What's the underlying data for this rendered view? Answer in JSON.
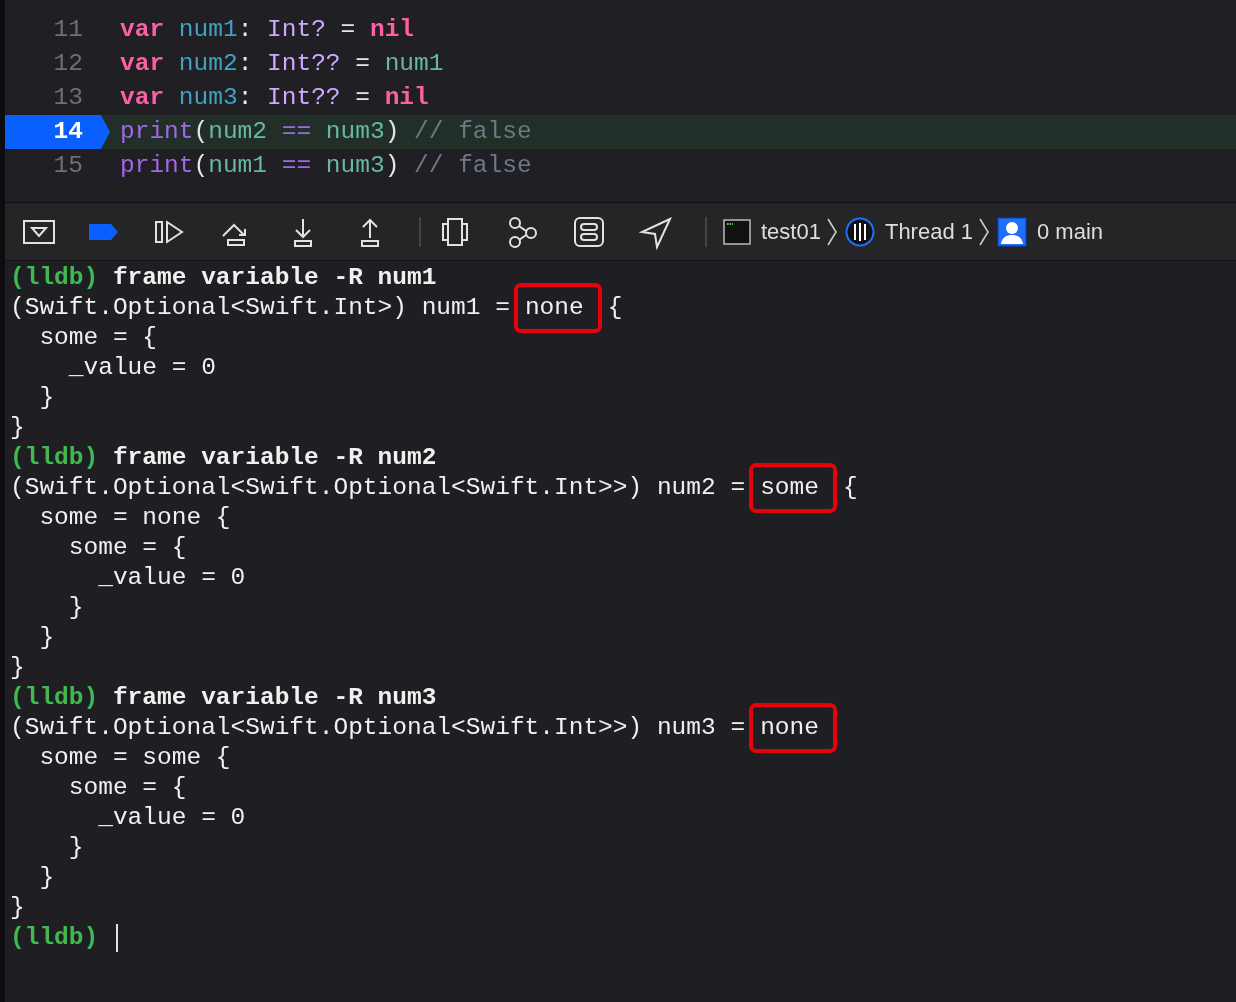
{
  "editor": {
    "lines": [
      {
        "number": "11",
        "current": false,
        "tokens": [
          {
            "kind": "keyword",
            "text": "var"
          },
          {
            "kind": "decl",
            "text": " num1"
          },
          {
            "kind": "plain",
            "text": ": "
          },
          {
            "kind": "type",
            "text": "Int?"
          },
          {
            "kind": "plain",
            "text": " = "
          },
          {
            "kind": "keyword",
            "text": "nil"
          }
        ]
      },
      {
        "number": "12",
        "current": false,
        "tokens": [
          {
            "kind": "keyword",
            "text": "var"
          },
          {
            "kind": "decl",
            "text": " num2"
          },
          {
            "kind": "plain",
            "text": ": "
          },
          {
            "kind": "type",
            "text": "Int??"
          },
          {
            "kind": "plain",
            "text": " = "
          },
          {
            "kind": "ref",
            "text": "num1"
          }
        ]
      },
      {
        "number": "13",
        "current": false,
        "tokens": [
          {
            "kind": "keyword",
            "text": "var"
          },
          {
            "kind": "decl",
            "text": " num3"
          },
          {
            "kind": "plain",
            "text": ": "
          },
          {
            "kind": "type",
            "text": "Int??"
          },
          {
            "kind": "plain",
            "text": " = "
          },
          {
            "kind": "keyword",
            "text": "nil"
          }
        ]
      },
      {
        "number": "14",
        "current": true,
        "tokens": [
          {
            "kind": "func",
            "text": "print"
          },
          {
            "kind": "plain",
            "text": "("
          },
          {
            "kind": "ref",
            "text": "num2"
          },
          {
            "kind": "op",
            "text": " =="
          },
          {
            "kind": "ref",
            "text": " num3"
          },
          {
            "kind": "plain",
            "text": ")"
          },
          {
            "kind": "comment",
            "text": " // false"
          }
        ]
      },
      {
        "number": "15",
        "current": false,
        "tokens": [
          {
            "kind": "func",
            "text": "print"
          },
          {
            "kind": "plain",
            "text": "("
          },
          {
            "kind": "ref",
            "text": "num1"
          },
          {
            "kind": "op",
            "text": " =="
          },
          {
            "kind": "ref",
            "text": " num3"
          },
          {
            "kind": "plain",
            "text": ")"
          },
          {
            "kind": "comment",
            "text": " // false"
          }
        ]
      }
    ]
  },
  "toolbar": {
    "breakpoints_enabled": true,
    "breadcrumbs": [
      {
        "kind": "target",
        "label": "test01"
      },
      {
        "kind": "thread",
        "label": "Thread 1"
      },
      {
        "kind": "frame",
        "label": "0 main"
      }
    ]
  },
  "console": {
    "lines": [
      {
        "kind": "command",
        "prompt": "(lldb)",
        "text": "frame variable -R num1"
      },
      {
        "kind": "output",
        "segments": [
          {
            "text": "(Swift.Optional<Swift.Int>) num1 =",
            "highlighted": false
          },
          {
            "text": "none",
            "highlighted": true
          },
          {
            "text": "{",
            "highlighted": false
          }
        ]
      },
      {
        "kind": "output",
        "segments": [
          {
            "text": "  some = {",
            "highlighted": false
          }
        ]
      },
      {
        "kind": "output",
        "segments": [
          {
            "text": "    _value = 0",
            "highlighted": false
          }
        ]
      },
      {
        "kind": "output",
        "segments": [
          {
            "text": "  }",
            "highlighted": false
          }
        ]
      },
      {
        "kind": "output",
        "segments": [
          {
            "text": "}",
            "highlighted": false
          }
        ]
      },
      {
        "kind": "command",
        "prompt": "(lldb)",
        "text": "frame variable -R num2"
      },
      {
        "kind": "output",
        "segments": [
          {
            "text": "(Swift.Optional<Swift.Optional<Swift.Int>>) num2 =",
            "highlighted": false
          },
          {
            "text": "some",
            "highlighted": true
          },
          {
            "text": "{",
            "highlighted": false
          }
        ]
      },
      {
        "kind": "output",
        "segments": [
          {
            "text": "  some = none {",
            "highlighted": false
          }
        ]
      },
      {
        "kind": "output",
        "segments": [
          {
            "text": "    some = {",
            "highlighted": false
          }
        ]
      },
      {
        "kind": "output",
        "segments": [
          {
            "text": "      _value = 0",
            "highlighted": false
          }
        ]
      },
      {
        "kind": "output",
        "segments": [
          {
            "text": "    }",
            "highlighted": false
          }
        ]
      },
      {
        "kind": "output",
        "segments": [
          {
            "text": "  }",
            "highlighted": false
          }
        ]
      },
      {
        "kind": "output",
        "segments": [
          {
            "text": "}",
            "highlighted": false
          }
        ]
      },
      {
        "kind": "command",
        "prompt": "(lldb)",
        "text": "frame variable -R num3"
      },
      {
        "kind": "output",
        "segments": [
          {
            "text": "(Swift.Optional<Swift.Optional<Swift.Int>>) num3 =",
            "highlighted": false
          },
          {
            "text": "none",
            "highlighted": true
          }
        ]
      },
      {
        "kind": "output",
        "segments": [
          {
            "text": "  some = some {",
            "highlighted": false
          }
        ]
      },
      {
        "kind": "output",
        "segments": [
          {
            "text": "    some = {",
            "highlighted": false
          }
        ]
      },
      {
        "kind": "output",
        "segments": [
          {
            "text": "      _value = 0",
            "highlighted": false
          }
        ]
      },
      {
        "kind": "output",
        "segments": [
          {
            "text": "    }",
            "highlighted": false
          }
        ]
      },
      {
        "kind": "output",
        "segments": [
          {
            "text": "  }",
            "highlighted": false
          }
        ]
      },
      {
        "kind": "output",
        "segments": [
          {
            "text": "}",
            "highlighted": false
          }
        ]
      },
      {
        "kind": "command",
        "prompt": "(lldb)",
        "cursor": true
      }
    ]
  }
}
